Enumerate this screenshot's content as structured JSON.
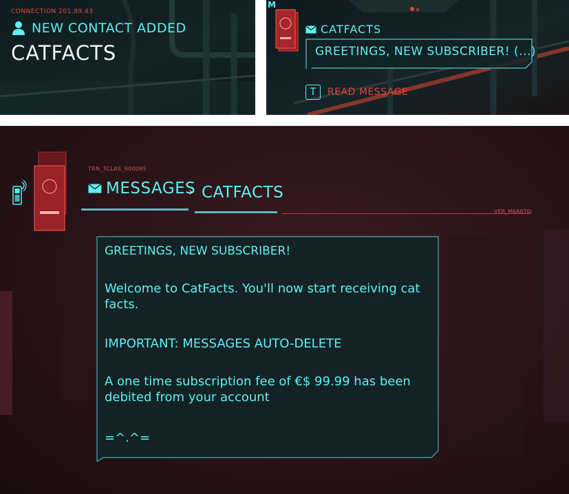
{
  "notification": {
    "connection": "CONNECTION 201.89.43",
    "new_contact_label": "NEW CONTACT ADDED",
    "contact_name": "CATFACTS"
  },
  "message_popup": {
    "corner_letter": "M",
    "sender": "CATFACTS",
    "preview": "GREETINGS, NEW SUBSCRIBER! (...)",
    "action_key": "T",
    "action_label": "READ MESSAGE"
  },
  "messages_screen": {
    "trn_code": "TRN_TCLAS_800095",
    "breadcrumb_root": "MESSAGES",
    "breadcrumb_sep": "›",
    "breadcrumb_current": "CATFACTS",
    "version_code": "VER_M6A6T6I",
    "message": {
      "title": "GREETINGS, NEW SUBSCRIBER!",
      "line1": "Welcome to CatFacts. You'll now start receiving cat facts.",
      "line2": "IMPORTANT: MESSAGES AUTO-DELETE",
      "line3": "A one time subscription fee of €$ 99.99 has been debited from your account",
      "line4": "=^.^="
    }
  },
  "colors": {
    "accent_cyan": "#5ef0f2",
    "accent_red": "#e0483f",
    "panel_bg": "#10191b"
  }
}
